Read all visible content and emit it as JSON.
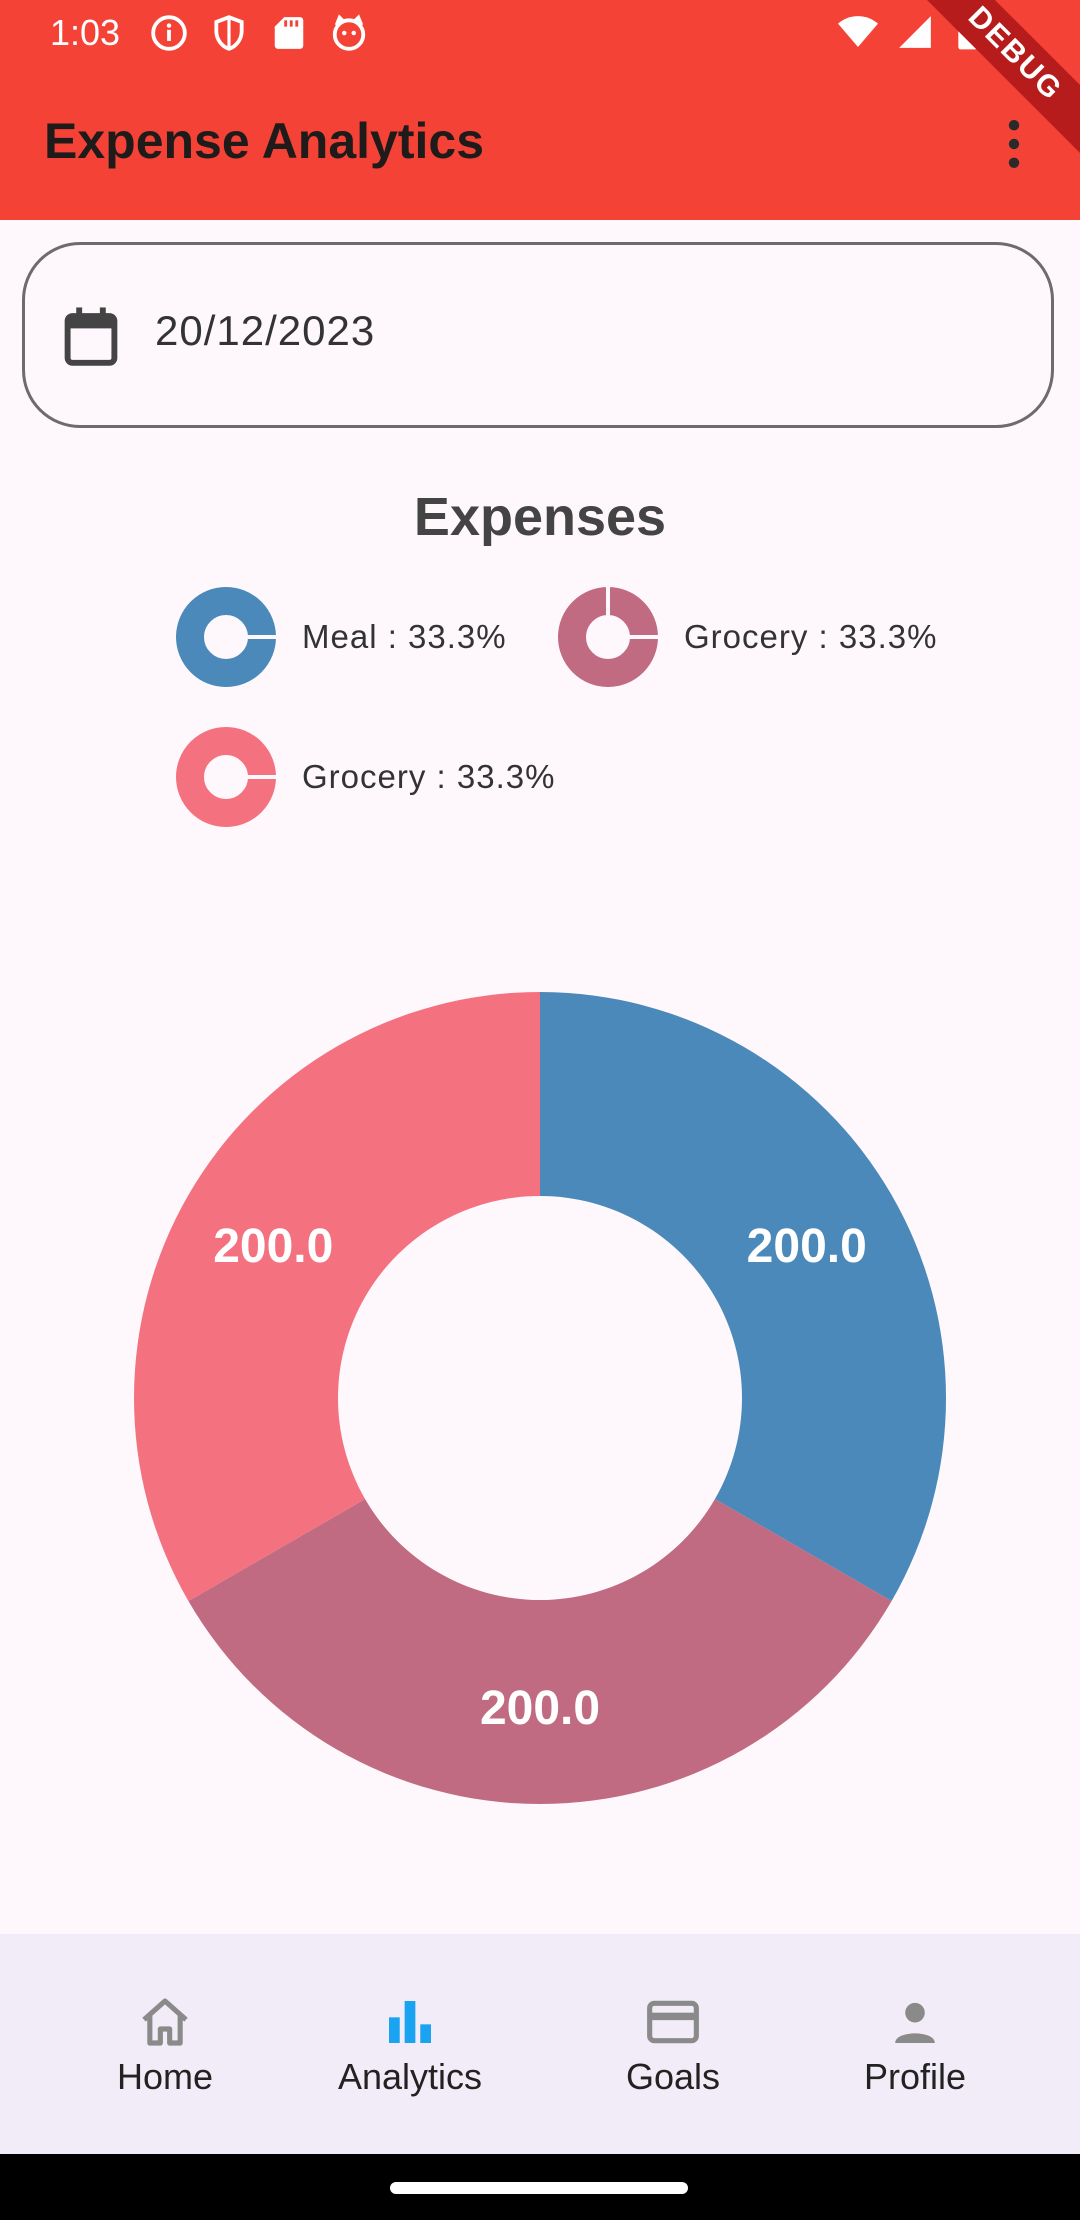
{
  "status_bar": {
    "time": "1:03",
    "icons": [
      "info-icon",
      "shield-icon",
      "sd-card-icon",
      "cat-icon",
      "wifi-icon",
      "signal-icon",
      "battery-icon"
    ]
  },
  "app_bar": {
    "title": "Expense Analytics",
    "menu_icon": "more-vert-icon",
    "background": "#f44336",
    "debug_banner": "DEBUG"
  },
  "date_picker": {
    "value": "20/12/2023",
    "icon": "calendar-icon"
  },
  "expenses": {
    "heading": "Expenses",
    "legend": [
      {
        "label": "Meal : 33.3%",
        "color": "#4a89b9"
      },
      {
        "label": "Grocery : 33.3%",
        "color": "#c06b82"
      },
      {
        "label": "Grocery : 33.3%",
        "color": "#f47280"
      }
    ]
  },
  "chart_data": {
    "type": "pie",
    "donut": true,
    "categories": [
      "Meal",
      "Grocery",
      "Grocery"
    ],
    "values": [
      200.0,
      200.0,
      200.0
    ],
    "data_labels": [
      "200.0",
      "200.0",
      "200.0"
    ],
    "colors": [
      "#4a89b9",
      "#c06b82",
      "#f47280"
    ]
  },
  "bottom_nav": {
    "items": [
      {
        "label": "Home",
        "icon": "home-icon",
        "active": false
      },
      {
        "label": "Analytics",
        "icon": "bar-chart-icon",
        "active": true
      },
      {
        "label": "Goals",
        "icon": "credit-card-icon",
        "active": false
      },
      {
        "label": "Profile",
        "icon": "person-icon",
        "active": false
      }
    ],
    "active_color": "#1aa3f0",
    "inactive_color": "#8a8a8a"
  }
}
